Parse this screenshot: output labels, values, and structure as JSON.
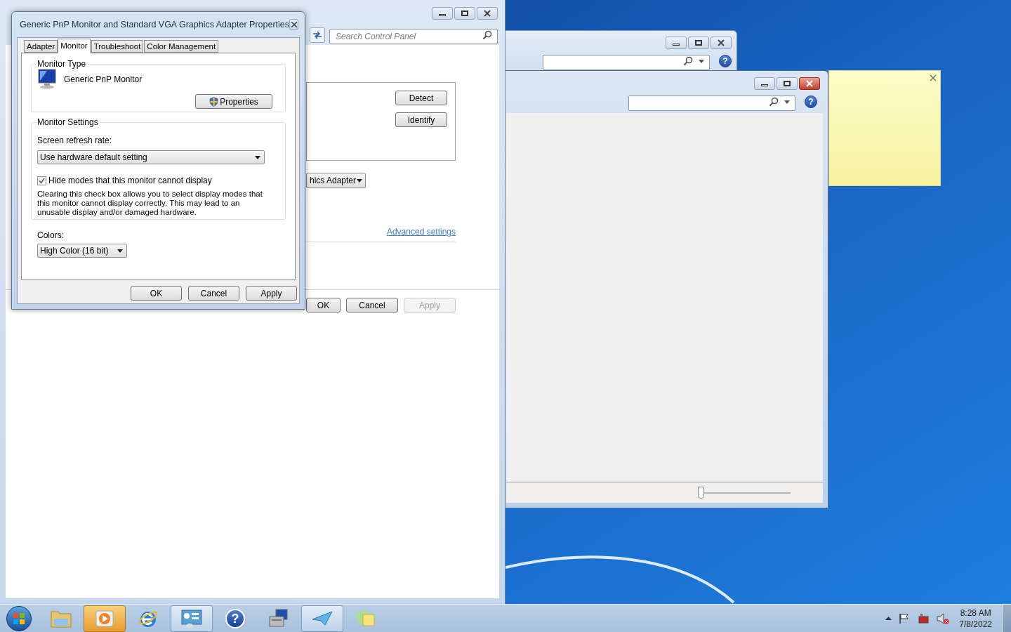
{
  "control_panel": {
    "search": {
      "placeholder": "Search Control Panel"
    },
    "display_buttons": [
      "Detect",
      "Identify"
    ],
    "adapter_dropdown": {
      "value": "hics Adapter"
    },
    "advanced_link": "Advanced settings",
    "buttons": [
      {
        "label": "OK",
        "disabled": false
      },
      {
        "label": "Cancel",
        "disabled": false
      },
      {
        "label": "Apply",
        "disabled": true
      }
    ]
  },
  "dialog": {
    "title": "Generic PnP Monitor and Standard VGA Graphics Adapter Properties",
    "tabs": [
      {
        "label": "Adapter",
        "selected": false
      },
      {
        "label": "Monitor",
        "selected": true
      },
      {
        "label": "Troubleshoot",
        "selected": false
      },
      {
        "label": "Color Management",
        "selected": false
      }
    ],
    "monitor_type": {
      "legend": "Monitor Type",
      "name": "Generic PnP Monitor",
      "button": "Properties"
    },
    "monitor_settings": {
      "legend": "Monitor Settings",
      "refresh_label": "Screen refresh rate:",
      "refresh_value": "Use hardware default setting",
      "checkbox": {
        "label": "Hide modes that this monitor cannot display",
        "checked": true
      },
      "note": "Clearing this check box allows you to select display modes that this monitor cannot display correctly. This may lead to an unusable display and/or damaged hardware."
    },
    "colors": {
      "label": "Colors:",
      "value": "High Color (16 bit)"
    },
    "buttons": [
      {
        "label": "OK",
        "disabled": false
      },
      {
        "label": "Cancel",
        "disabled": false
      },
      {
        "label": "Apply",
        "disabled": false
      }
    ]
  },
  "back_window": {
    "help_glyph": "?"
  },
  "front_window": {
    "help_glyph": "?",
    "zoom_slider": {
      "level": 0
    }
  },
  "taskbar": {
    "items": [
      {
        "kind": "explorer",
        "selected": false,
        "hovered": false
      },
      {
        "kind": "media",
        "selected": false,
        "hovered": true
      },
      {
        "kind": "browser",
        "selected": false,
        "hovered": false
      },
      {
        "kind": "control-panel",
        "selected": true,
        "hovered": false
      },
      {
        "kind": "help",
        "selected": false,
        "hovered": false,
        "glyph": "?"
      },
      {
        "kind": "device",
        "selected": false,
        "hovered": false
      },
      {
        "kind": "snipping",
        "selected": true,
        "hovered": false
      },
      {
        "kind": "notes",
        "selected": false,
        "hovered": false
      }
    ],
    "clock": {
      "time": "8:28 AM",
      "date": "7/8/2022"
    }
  }
}
